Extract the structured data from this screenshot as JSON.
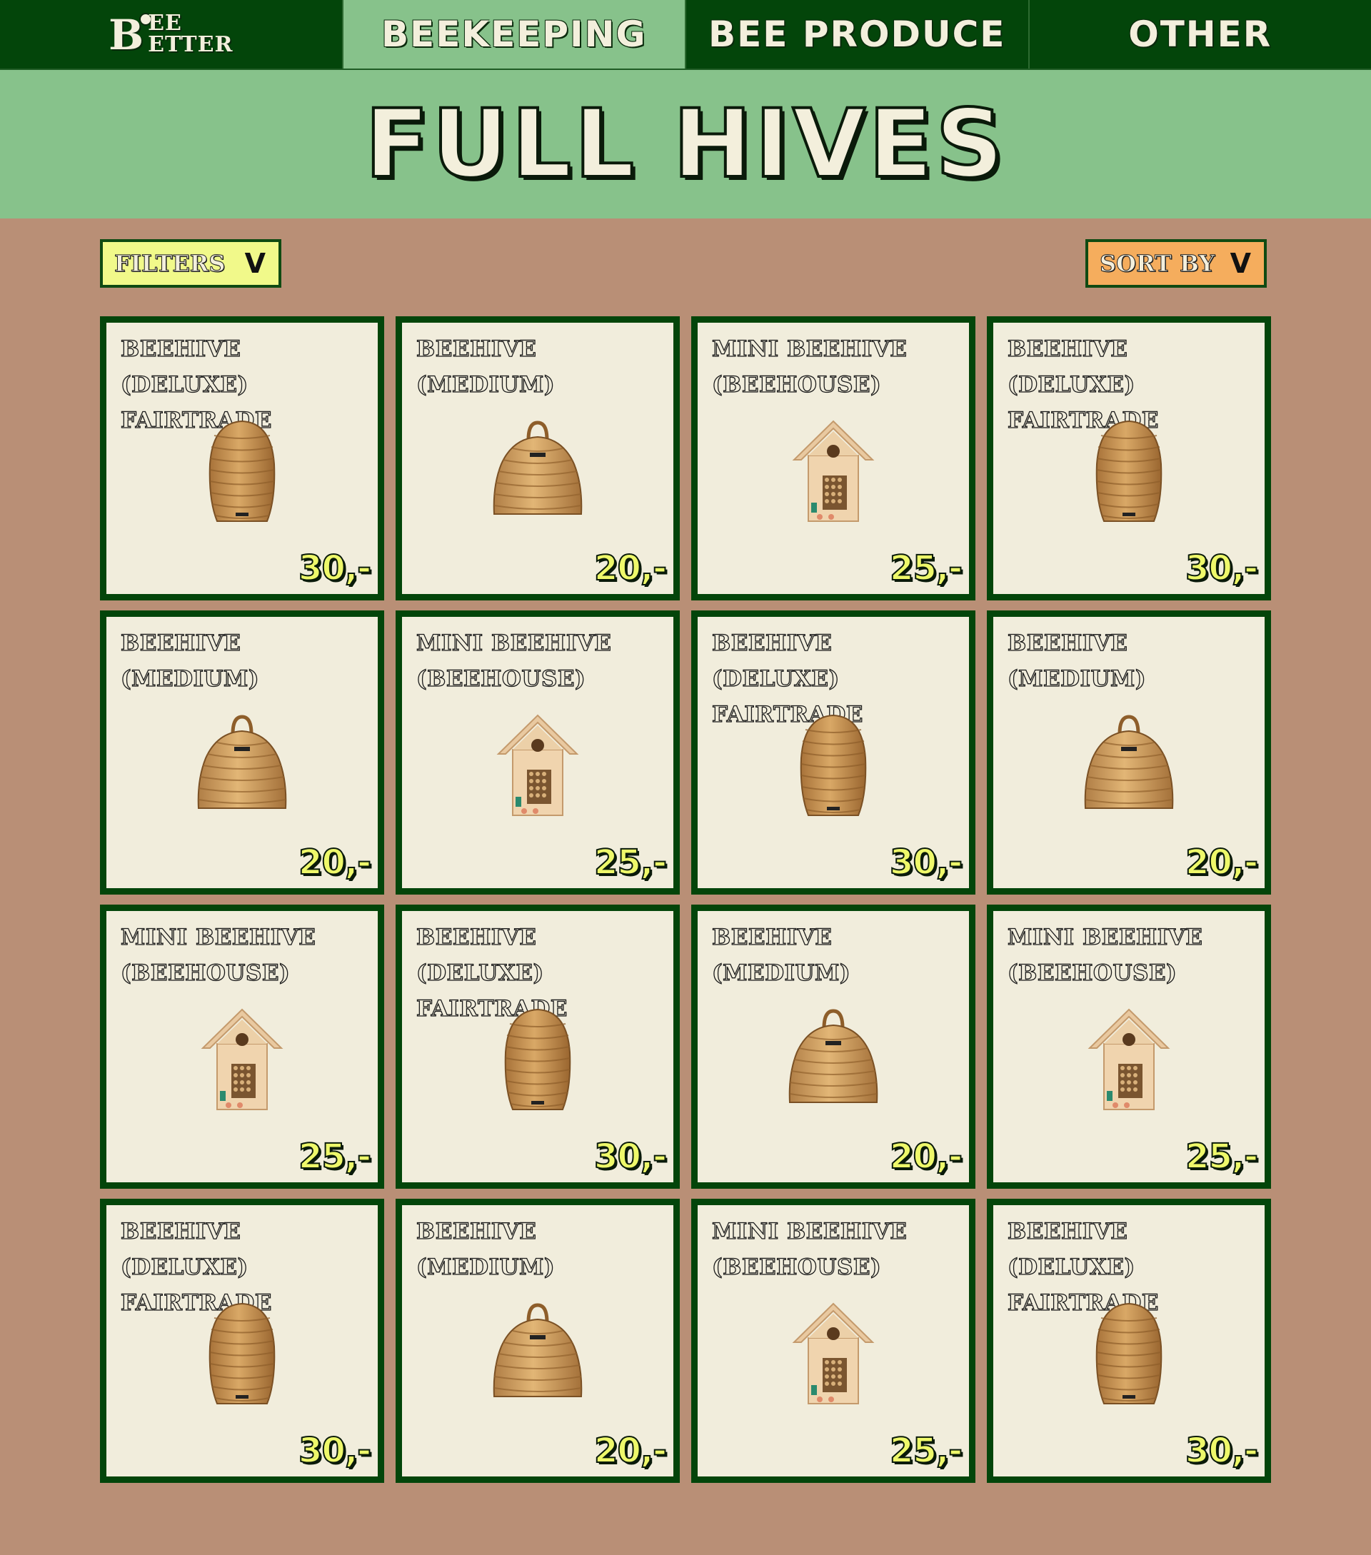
{
  "nav": {
    "logo_letter": "B",
    "logo_line1": "EE",
    "logo_line2": "ETTER",
    "items": [
      {
        "label": "Beekeeping",
        "active": true
      },
      {
        "label": "Bee Produce",
        "active": false
      },
      {
        "label": "Other",
        "active": false
      }
    ]
  },
  "hero": {
    "title": "Full Hives"
  },
  "controls": {
    "filters_label": "Filters",
    "sort_label": "Sort by",
    "chevron": "V"
  },
  "colors": {
    "nav_bg": "#03450a",
    "active_tab_bg": "#87c28b",
    "page_bg": "#b98f76",
    "card_bg": "#f1eddc",
    "card_border": "#03450a",
    "filters_bg": "#f1f98a",
    "sort_bg": "#f5ad5d",
    "price_color": "#eef86a"
  },
  "products": [
    {
      "name": "Beehive (Deluxe) Fairtrade",
      "price": "30,-",
      "image": "skep-tall-icon"
    },
    {
      "name": "Beehive (Medium)",
      "price": "20,-",
      "image": "skep-handle-icon"
    },
    {
      "name": "Mini beehive (beehouse)",
      "price": "25,-",
      "image": "bee-house-icon"
    },
    {
      "name": "Beehive (Deluxe) Fairtrade",
      "price": "30,-",
      "image": "skep-tall-icon"
    },
    {
      "name": "Beehive (Medium)",
      "price": "20,-",
      "image": "skep-handle-icon"
    },
    {
      "name": "Mini beehive (beehouse)",
      "price": "25,-",
      "image": "bee-house-icon"
    },
    {
      "name": "Beehive (Deluxe) Fairtrade",
      "price": "30,-",
      "image": "skep-tall-icon"
    },
    {
      "name": "Beehive (Medium)",
      "price": "20,-",
      "image": "skep-handle-icon"
    },
    {
      "name": "Mini beehive (beehouse)",
      "price": "25,-",
      "image": "bee-house-icon"
    },
    {
      "name": "Beehive (Deluxe) Fairtrade",
      "price": "30,-",
      "image": "skep-tall-icon"
    },
    {
      "name": "Beehive (Medium)",
      "price": "20,-",
      "image": "skep-handle-icon"
    },
    {
      "name": "Mini beehive (beehouse)",
      "price": "25,-",
      "image": "bee-house-icon"
    },
    {
      "name": "Beehive (Deluxe) Fairtrade",
      "price": "30,-",
      "image": "skep-tall-icon"
    },
    {
      "name": "Beehive (Medium)",
      "price": "20,-",
      "image": "skep-handle-icon"
    },
    {
      "name": "Mini beehive (beehouse)",
      "price": "25,-",
      "image": "bee-house-icon"
    },
    {
      "name": "Beehive (Deluxe) Fairtrade",
      "price": "30,-",
      "image": "skep-tall-icon"
    }
  ]
}
